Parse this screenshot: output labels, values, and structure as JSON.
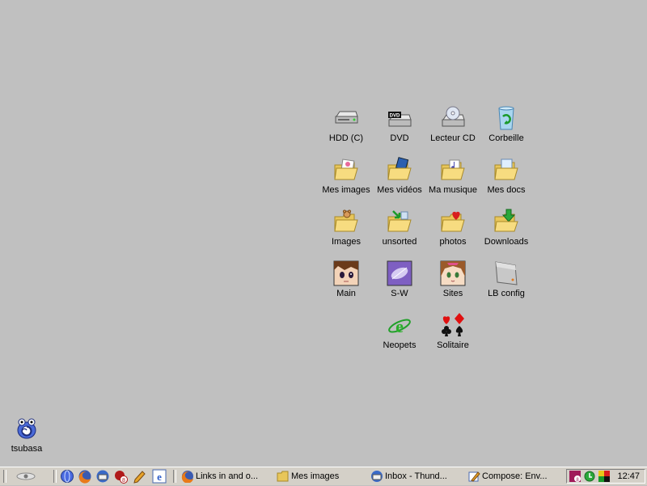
{
  "desktop": {
    "icons": {
      "hdd": "HDD (C)",
      "dvd": "DVD",
      "lecteur_cd": "Lecteur CD",
      "corbeille": "Corbeille",
      "mes_images": "Mes images",
      "mes_videos": "Mes vidéos",
      "ma_musique": "Ma musique",
      "mes_docs": "Mes docs",
      "images": "Images",
      "unsorted": "unsorted",
      "photos": "photos",
      "downloads": "Downloads",
      "main": "Main",
      "sw": "S-W",
      "sites": "Sites",
      "lb_config": "LB config",
      "neopets": "Neopets",
      "solitaire": "Solitaire",
      "tsubasa": "tsubasa"
    },
    "dvd_badge": "DVD"
  },
  "taskbar": {
    "quick_launch": [
      "show-desktop-icon",
      "firefox-icon",
      "thunderbird-icon",
      "badge-app-icon",
      "pencil-app-icon",
      "ie-icon"
    ],
    "quick_badge": "8",
    "buttons": [
      {
        "label": "Links in and o...",
        "icon": "firefox-icon"
      },
      {
        "label": "Mes images",
        "icon": "folder-icon"
      },
      {
        "label": "Inbox - Thund...",
        "icon": "thunderbird-icon"
      },
      {
        "label": "Compose: Env...",
        "icon": "compose-icon"
      }
    ],
    "tray": {
      "badge": "8",
      "clock": "12:47"
    }
  }
}
